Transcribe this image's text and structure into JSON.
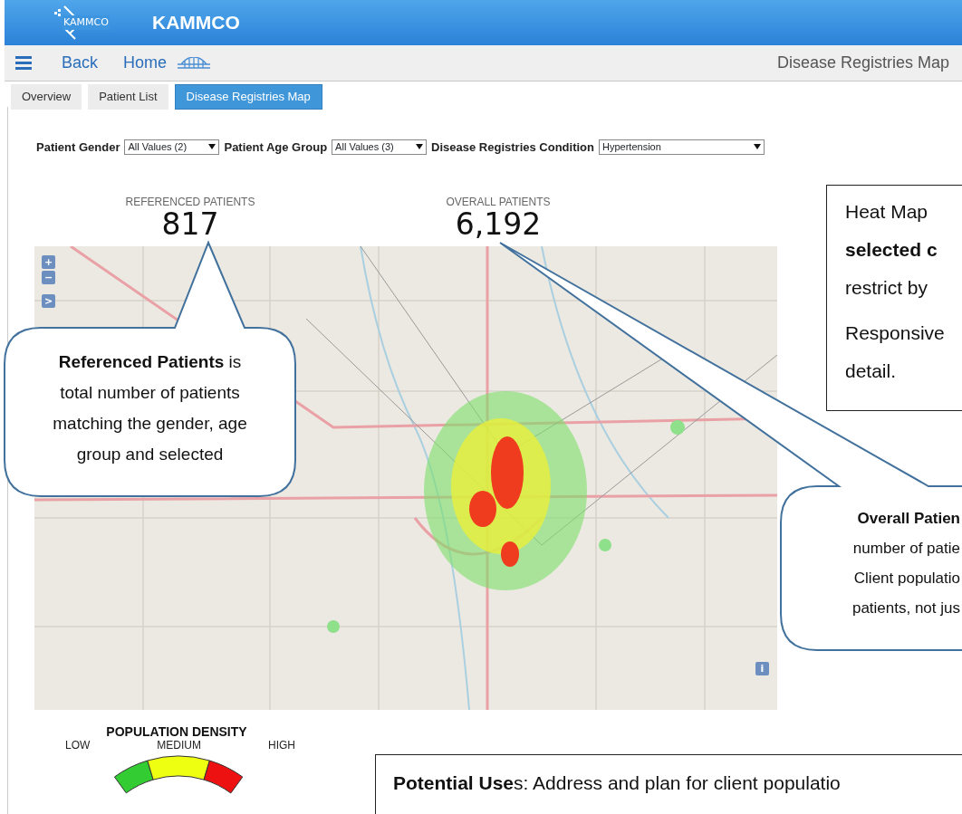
{
  "header": {
    "logo_text": "KAMMCO",
    "title": "KAMMCO"
  },
  "nav": {
    "back": "Back",
    "home": "Home",
    "page_title": "Disease Registries Map"
  },
  "tabs": [
    {
      "label": "Overview",
      "selected": false
    },
    {
      "label": "Patient List",
      "selected": false
    },
    {
      "label": "Disease Registries Map",
      "selected": true
    }
  ],
  "filters": [
    {
      "label": "Patient Gender",
      "value": "All Values (2)",
      "kind": "short"
    },
    {
      "label": "Patient Age Group",
      "value": "All Values (3)",
      "kind": "short"
    },
    {
      "label": "Disease Registries Condition",
      "value": "Hypertension",
      "kind": "wide"
    }
  ],
  "stats": [
    {
      "label": "REFERENCED PATIENTS",
      "value": "817"
    },
    {
      "label": "OVERALL PATIENTS",
      "value": "6,192"
    }
  ],
  "map": {
    "controls": [
      "+",
      "−",
      ">",
      "i"
    ]
  },
  "legend": {
    "title": "POPULATION DENSITY",
    "scale_labels": [
      "LOW",
      "MEDIUM",
      "HIGH"
    ],
    "segments": [
      {
        "color": "#33cc33"
      },
      {
        "color": "#eeff11"
      },
      {
        "color": "#ee1111"
      }
    ]
  },
  "annotations": [
    {
      "kind": "callout",
      "lines": [
        "**Referenced Patients** is",
        "total number of patients",
        "matching the gender, age",
        "group and selected"
      ]
    },
    {
      "kind": "note",
      "paragraphs": [
        [
          "Heat Map",
          "**selected c**",
          "restrict by"
        ],
        [
          "Responsive",
          "detail."
        ]
      ]
    },
    {
      "kind": "callout",
      "lines": [
        "**Overall Patien**",
        "number of patie",
        "Client populatio",
        "patients, not jus"
      ]
    },
    {
      "kind": "note",
      "paragraphs": [
        [
          "**Potential Use**s: Address and plan for client populatio"
        ]
      ]
    }
  ]
}
